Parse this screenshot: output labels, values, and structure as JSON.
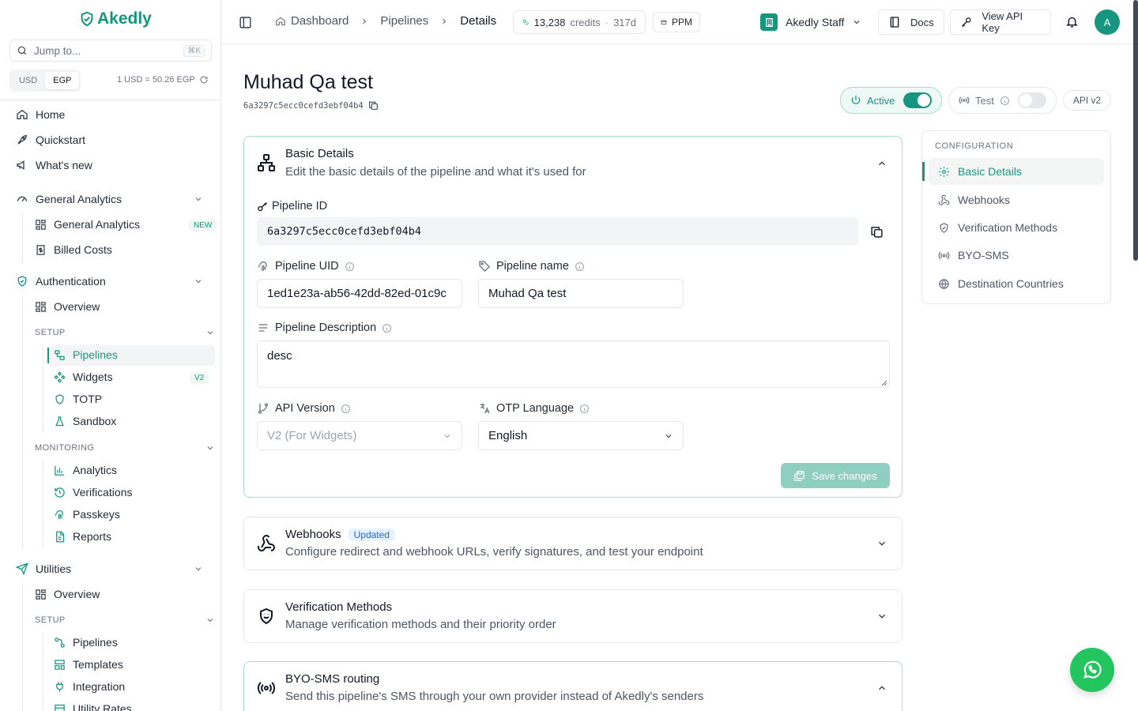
{
  "sidebar": {
    "logo": "Akedly",
    "jump": {
      "placeholder": "Jump to...",
      "shortcut": "⌘K"
    },
    "currency": {
      "usd": "USD",
      "egp": "EGP",
      "rate": "1 USD = 50.26 EGP"
    },
    "top_items": [
      {
        "label": "Home",
        "icon": "home-icon"
      },
      {
        "label": "Quickstart",
        "icon": "rocket-icon"
      },
      {
        "label": "What's new",
        "icon": "megaphone-icon"
      }
    ],
    "general_analytics": {
      "label": "General Analytics",
      "items": [
        {
          "label": "General Analytics",
          "badge": "NEW"
        },
        {
          "label": "Billed Costs"
        }
      ]
    },
    "authentication": {
      "label": "Authentication",
      "overview": "Overview",
      "setup_label": "SETUP",
      "setup_items": [
        {
          "label": "Pipelines"
        },
        {
          "label": "Widgets",
          "badge": "V2"
        },
        {
          "label": "TOTP"
        },
        {
          "label": "Sandbox"
        }
      ],
      "monitoring_label": "MONITORING",
      "monitoring_items": [
        {
          "label": "Analytics"
        },
        {
          "label": "Verifications"
        },
        {
          "label": "Passkeys"
        },
        {
          "label": "Reports"
        }
      ]
    },
    "utilities": {
      "label": "Utilities",
      "overview": "Overview",
      "setup_label": "SETUP",
      "setup_items": [
        {
          "label": "Pipelines"
        },
        {
          "label": "Templates"
        },
        {
          "label": "Integration"
        },
        {
          "label": "Utility Rates"
        }
      ]
    }
  },
  "topbar": {
    "breadcrumb": [
      "Dashboard",
      "Pipelines",
      "Details"
    ],
    "credits": "13,238",
    "credits_label": "credits",
    "credits_days": "317d",
    "ppm": "PPM",
    "org": "Akedly Staff",
    "docs": "Docs",
    "api_key": "View API Key",
    "avatar": "A"
  },
  "page": {
    "title": "Muhad Qa test",
    "id": "6a3297c5ecc0cefd3ebf04b4",
    "status": {
      "active": "Active",
      "test": "Test",
      "api": "API v2",
      "active_on": true,
      "test_on": false
    }
  },
  "basic": {
    "title": "Basic Details",
    "desc": "Edit the basic details of the pipeline and what it's used for",
    "pipeline_id_label": "Pipeline ID",
    "pipeline_id": "6a3297c5ecc0cefd3ebf04b4",
    "uid_label": "Pipeline UID",
    "uid": "1ed1e23a-ab56-42dd-82ed-01c9c",
    "name_label": "Pipeline name",
    "name": "Muhad Qa test",
    "desc_label": "Pipeline Description",
    "description": "desc",
    "api_label": "API Version",
    "api_value": "V2 (For Widgets)",
    "otp_label": "OTP Language",
    "otp_value": "English",
    "save": "Save changes"
  },
  "webhooks": {
    "title": "Webhooks",
    "badge": "Updated",
    "desc": "Configure redirect and webhook URLs, verify signatures, and test your endpoint"
  },
  "verification": {
    "title": "Verification Methods",
    "desc": "Manage verification methods and their priority order"
  },
  "byo": {
    "title": "BYO-SMS routing",
    "desc": "Send this pipeline's SMS through your own provider instead of Akedly's senders"
  },
  "config": {
    "heading": "CONFIGURATION",
    "items": [
      {
        "label": "Basic Details",
        "icon": "gear-icon",
        "active": true
      },
      {
        "label": "Webhooks",
        "icon": "webhook-icon"
      },
      {
        "label": "Verification Methods",
        "icon": "shield-check-icon"
      },
      {
        "label": "BYO-SMS",
        "icon": "broadcast-icon"
      },
      {
        "label": "Destination Countries",
        "icon": "globe-icon"
      }
    ]
  },
  "colors": {
    "brand": "#16957f",
    "border": "#e5e7eb"
  }
}
